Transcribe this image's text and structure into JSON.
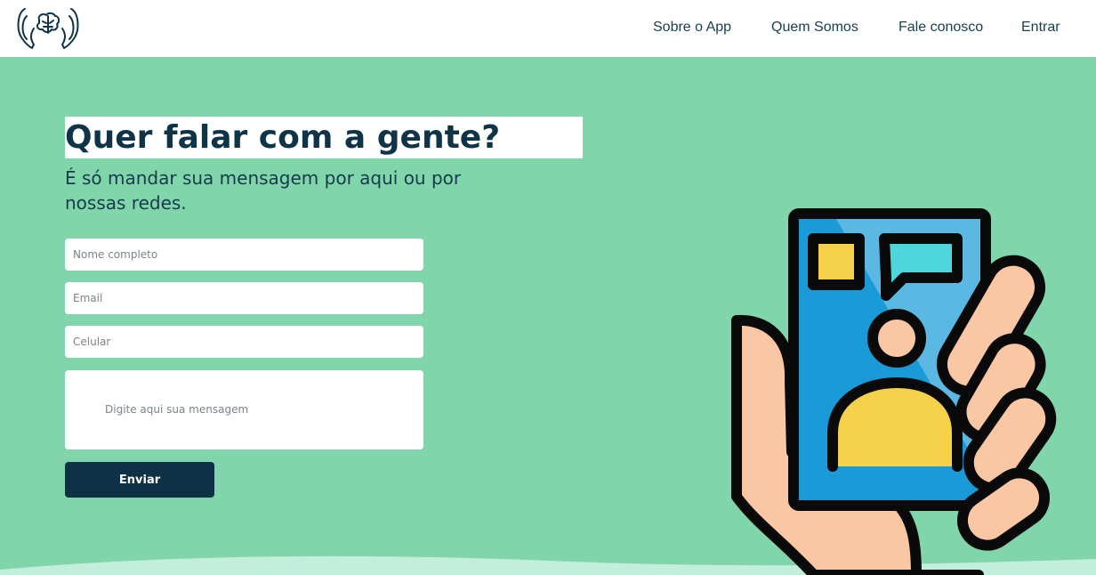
{
  "header": {
    "logo_icon": "brain-in-hands-logo",
    "nav": [
      {
        "label": "Sobre o App"
      },
      {
        "label": "Quem Somos"
      },
      {
        "label": "Fale conosco"
      },
      {
        "label": "Entrar"
      }
    ]
  },
  "hero": {
    "title": "Quer falar com a gente?",
    "subtitle": "É só mandar sua mensagem por aqui ou por nossas redes."
  },
  "form": {
    "name_placeholder": "Nome completo",
    "email_placeholder": "Email",
    "phone_placeholder": "Celular",
    "message_placeholder": "Digite aqui sua mensagem",
    "submit_label": "Enviar"
  },
  "colors": {
    "background": "#80d5ab",
    "primary": "#0e3146",
    "header": "#ffffff"
  },
  "illustration_icon": "hand-holding-phone-contact"
}
